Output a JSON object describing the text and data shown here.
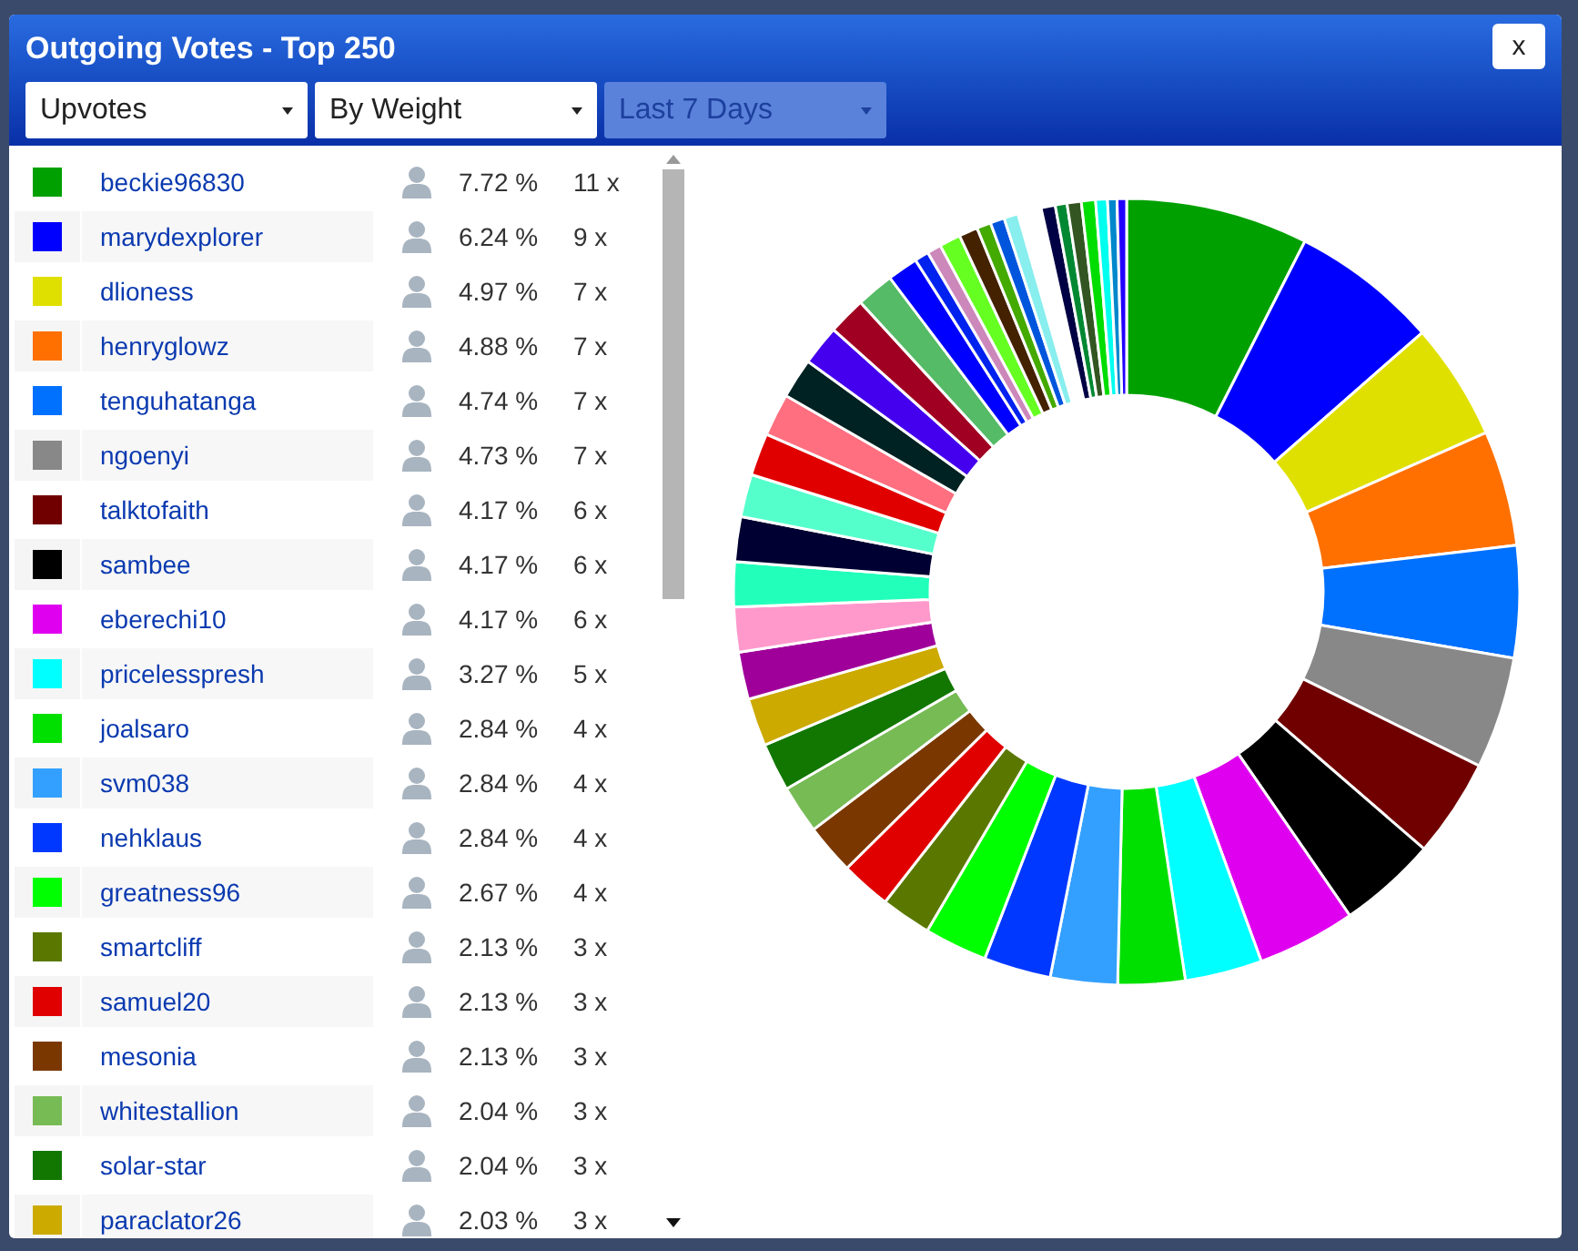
{
  "dialog": {
    "title": "Outgoing Votes - Top 250",
    "close_label": "x",
    "filters": [
      {
        "label": "Upvotes",
        "disabled": false
      },
      {
        "label": "By Weight",
        "disabled": false
      },
      {
        "label": "Last 7 Days",
        "disabled": true
      }
    ]
  },
  "voters": [
    {
      "name": "beckie96830",
      "color": "#00a000",
      "share": "7.72 %",
      "count": "11 x"
    },
    {
      "name": "marydexplorer",
      "color": "#0000ff",
      "share": "6.24 %",
      "count": "9 x"
    },
    {
      "name": "dlioness",
      "color": "#e0e000",
      "share": "4.97 %",
      "count": "7 x"
    },
    {
      "name": "henryglowz",
      "color": "#ff7000",
      "share": "4.88 %",
      "count": "7 x"
    },
    {
      "name": "tenguhatanga",
      "color": "#0070ff",
      "share": "4.74 %",
      "count": "7 x"
    },
    {
      "name": "ngoenyi",
      "color": "#888888",
      "share": "4.73 %",
      "count": "7 x"
    },
    {
      "name": "talktofaith",
      "color": "#700000",
      "share": "4.17 %",
      "count": "6 x"
    },
    {
      "name": "sambee",
      "color": "#000000",
      "share": "4.17 %",
      "count": "6 x"
    },
    {
      "name": "eberechi10",
      "color": "#e000f0",
      "share": "4.17 %",
      "count": "6 x"
    },
    {
      "name": "pricelesspresh",
      "color": "#00ffff",
      "share": "3.27 %",
      "count": "5 x"
    },
    {
      "name": "joalsaro",
      "color": "#00e000",
      "share": "2.84 %",
      "count": "4 x"
    },
    {
      "name": "svm038",
      "color": "#33a0ff",
      "share": "2.84 %",
      "count": "4 x"
    },
    {
      "name": "nehklaus",
      "color": "#0038ff",
      "share": "2.84 %",
      "count": "4 x"
    },
    {
      "name": "greatness96",
      "color": "#00ff00",
      "share": "2.67 %",
      "count": "4 x"
    },
    {
      "name": "smartcliff",
      "color": "#5a7800",
      "share": "2.13 %",
      "count": "3 x"
    },
    {
      "name": "samuel20",
      "color": "#e00000",
      "share": "2.13 %",
      "count": "3 x"
    },
    {
      "name": "mesonia",
      "color": "#7a3800",
      "share": "2.13 %",
      "count": "3 x"
    },
    {
      "name": "whitestallion",
      "color": "#77bb55",
      "share": "2.04 %",
      "count": "3 x"
    },
    {
      "name": "solar-star",
      "color": "#117700",
      "share": "2.04 %",
      "count": "3 x"
    },
    {
      "name": "paraclator26",
      "color": "#ccaa00",
      "share": "2.03 %",
      "count": "3 x"
    }
  ]
}
